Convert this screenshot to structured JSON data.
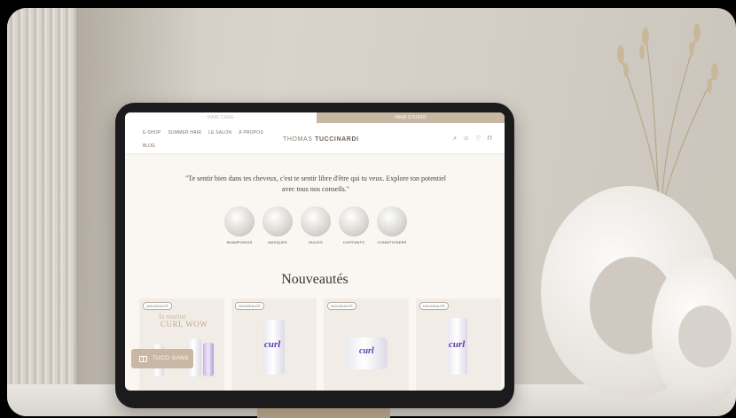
{
  "topbar": {
    "hair_care": "HAIR CARE",
    "hair_studio": "HAIR STUDIO"
  },
  "header": {
    "nav": [
      "E-SHOP",
      "SUMMER HAIR",
      "LE SALON",
      "À PROPOS"
    ],
    "blog": "BLOG",
    "brand_light": "THOMAS ",
    "brand_bold": "TUCCINARDI"
  },
  "quote": "\"Te sentir bien dans tes cheveux, c'est te sentir libre d'être qui tu veux. Explore ton potentiel avec tous nos conseils.\"",
  "categories": [
    "SHAMPOINGS",
    "MASQUES",
    "HUILES",
    "COIFFANTS",
    "CONDITIONERS"
  ],
  "section_title": "Nouveautés",
  "products": {
    "badge": "NOUVEAUTÉ",
    "promo_sub": "la routine",
    "promo_title": "CURL WOW",
    "curl": "curl"
  },
  "chip": {
    "label": "TUCCI GANG"
  }
}
